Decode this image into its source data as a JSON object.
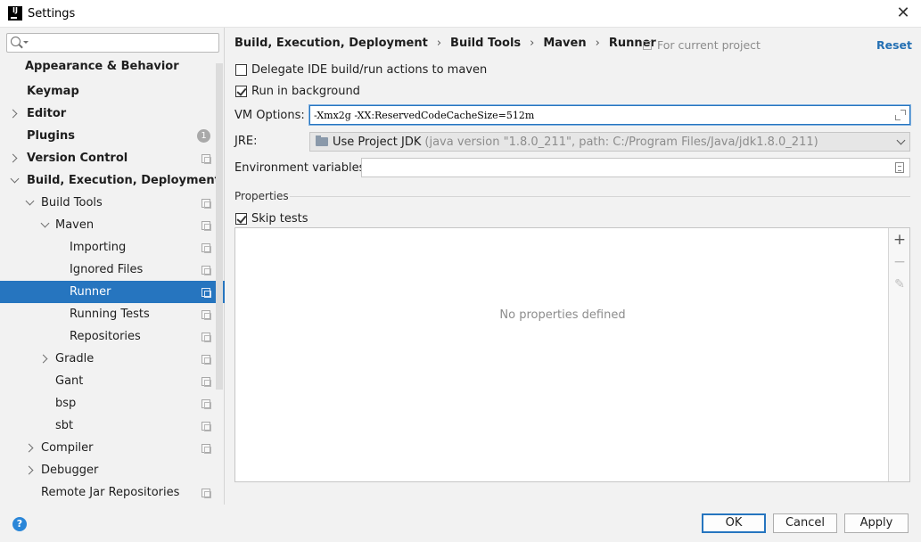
{
  "window": {
    "title": "Settings",
    "app_icon_text": "IJ",
    "close_symbol": "✕"
  },
  "sidebar": {
    "search": {
      "value": "",
      "placeholder": ""
    },
    "items": [
      {
        "label": "Appearance & Behavior",
        "bold": true,
        "badge": ""
      },
      {
        "label": "Keymap",
        "bold": true
      },
      {
        "label": "Editor",
        "bold": true
      },
      {
        "label": "Plugins",
        "bold": true,
        "badge": "1"
      },
      {
        "label": "Version Control",
        "bold": true
      },
      {
        "label": "Build, Execution, Deployment",
        "bold": true
      },
      {
        "label": "Build Tools"
      },
      {
        "label": "Maven"
      },
      {
        "label": "Importing"
      },
      {
        "label": "Ignored Files"
      },
      {
        "label": "Runner",
        "selected": true
      },
      {
        "label": "Running Tests"
      },
      {
        "label": "Repositories"
      },
      {
        "label": "Gradle"
      },
      {
        "label": "Gant"
      },
      {
        "label": "bsp"
      },
      {
        "label": "sbt"
      },
      {
        "label": "Compiler"
      },
      {
        "label": "Debugger"
      },
      {
        "label": "Remote Jar Repositories"
      }
    ]
  },
  "main": {
    "breadcrumb": [
      "Build, Execution, Deployment",
      "Build Tools",
      "Maven",
      "Runner"
    ],
    "breadcrumb_sep": "›",
    "for_current_project": "For current project",
    "reset": "Reset",
    "delegate_label": "Delegate IDE build/run actions to maven",
    "delegate_checked": false,
    "background_label": "Run in background",
    "background_checked": true,
    "vm_options_label": "VM Options:",
    "vm_options_value": "-Xmx2g -XX:ReservedCodeCacheSize=512m",
    "jre_label": "JRE:",
    "jre_value": "Use Project JDK",
    "jre_detail": "(java version \"1.8.0_211\", path: C:/Program Files/Java/jdk1.8.0_211)",
    "env_label": "Environment variables:",
    "env_value": "",
    "properties_title": "Properties",
    "skip_tests_label": "Skip tests",
    "skip_tests_checked": true,
    "empty_properties": "No properties defined",
    "tool_add": "+",
    "tool_remove": "−",
    "tool_edit": "✎"
  },
  "footer": {
    "help": "?",
    "ok": "OK",
    "cancel": "Cancel",
    "apply": "Apply"
  },
  "colors": {
    "selection": "#2675bf",
    "link": "#2470b3",
    "background": "#f2f2f2"
  }
}
